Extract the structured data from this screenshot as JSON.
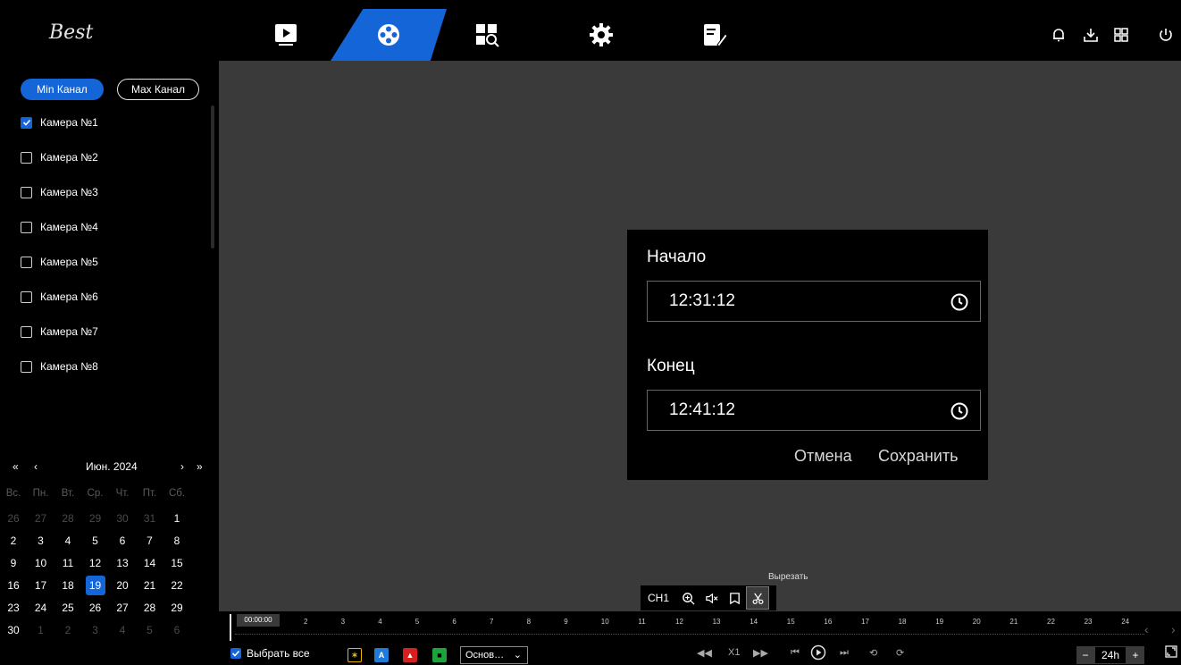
{
  "app": {
    "logo_text": "Best"
  },
  "nav": {
    "items": [
      {
        "name": "live-view",
        "icon": "play-icon",
        "active": false
      },
      {
        "name": "playback",
        "icon": "film-reel-icon",
        "active": true
      },
      {
        "name": "search",
        "icon": "search-icon",
        "active": false
      },
      {
        "name": "settings",
        "icon": "gear-icon",
        "active": false
      },
      {
        "name": "maintenance",
        "icon": "tools-icon",
        "active": false
      }
    ],
    "right_icons": [
      "bell-icon",
      "download-icon",
      "grid-icon",
      "power-icon"
    ]
  },
  "colors": {
    "accent": "#1465d8",
    "video_bg": "#3a3a3a",
    "event_motion": "#e8b800",
    "event_ai": "#1f7ad8",
    "event_alarm": "#d62020",
    "event_video": "#1ea33c"
  },
  "channels": {
    "min_label": "Min Канал",
    "max_label": "Max Канал",
    "cameras": [
      {
        "label": "Камера №1",
        "checked": true
      },
      {
        "label": "Камера №2",
        "checked": false
      },
      {
        "label": "Камера №3",
        "checked": false
      },
      {
        "label": "Камера №4",
        "checked": false
      },
      {
        "label": "Камера №5",
        "checked": false
      },
      {
        "label": "Камера №6",
        "checked": false
      },
      {
        "label": "Камера №7",
        "checked": false
      },
      {
        "label": "Камера №8",
        "checked": false
      }
    ]
  },
  "calendar": {
    "prev_year": "«",
    "prev_month": "‹",
    "next_month": "›",
    "next_year": "»",
    "month_label": "Июн. 2024",
    "weekdays": [
      "Вс.",
      "Пн.",
      "Вт.",
      "Ср.",
      "Чт.",
      "Пт.",
      "Сб."
    ],
    "days": [
      [
        "26",
        "27",
        "28",
        "29",
        "30",
        "31",
        "1"
      ],
      [
        "2",
        "3",
        "4",
        "5",
        "6",
        "7",
        "8"
      ],
      [
        "9",
        "10",
        "11",
        "12",
        "13",
        "14",
        "15"
      ],
      [
        "16",
        "17",
        "18",
        "19",
        "20",
        "21",
        "22"
      ],
      [
        "23",
        "24",
        "25",
        "26",
        "27",
        "28",
        "29"
      ],
      [
        "30",
        "1",
        "2",
        "3",
        "4",
        "5",
        "6"
      ]
    ],
    "selected": "19"
  },
  "dialog": {
    "start_label": "Начало",
    "start_value": "12:31:12",
    "end_label": "Конец",
    "end_value": "12:41:12",
    "cancel": "Отмена",
    "save": "Сохранить"
  },
  "player_toolbar": {
    "channel": "CH1",
    "tooltip": "Вырезать"
  },
  "timeline": {
    "start_time": "00:00:00",
    "ticks": [
      "2",
      "3",
      "4",
      "5",
      "6",
      "7",
      "8",
      "9",
      "10",
      "11",
      "12",
      "13",
      "14",
      "15",
      "16",
      "17",
      "18",
      "19",
      "20",
      "21",
      "22",
      "23",
      "24"
    ]
  },
  "bottombar": {
    "select_all": "Выбрать все",
    "stream": "Основ…",
    "speed": "X1",
    "zoom_minus": "−",
    "zoom_value": "24h",
    "zoom_plus": "+"
  }
}
